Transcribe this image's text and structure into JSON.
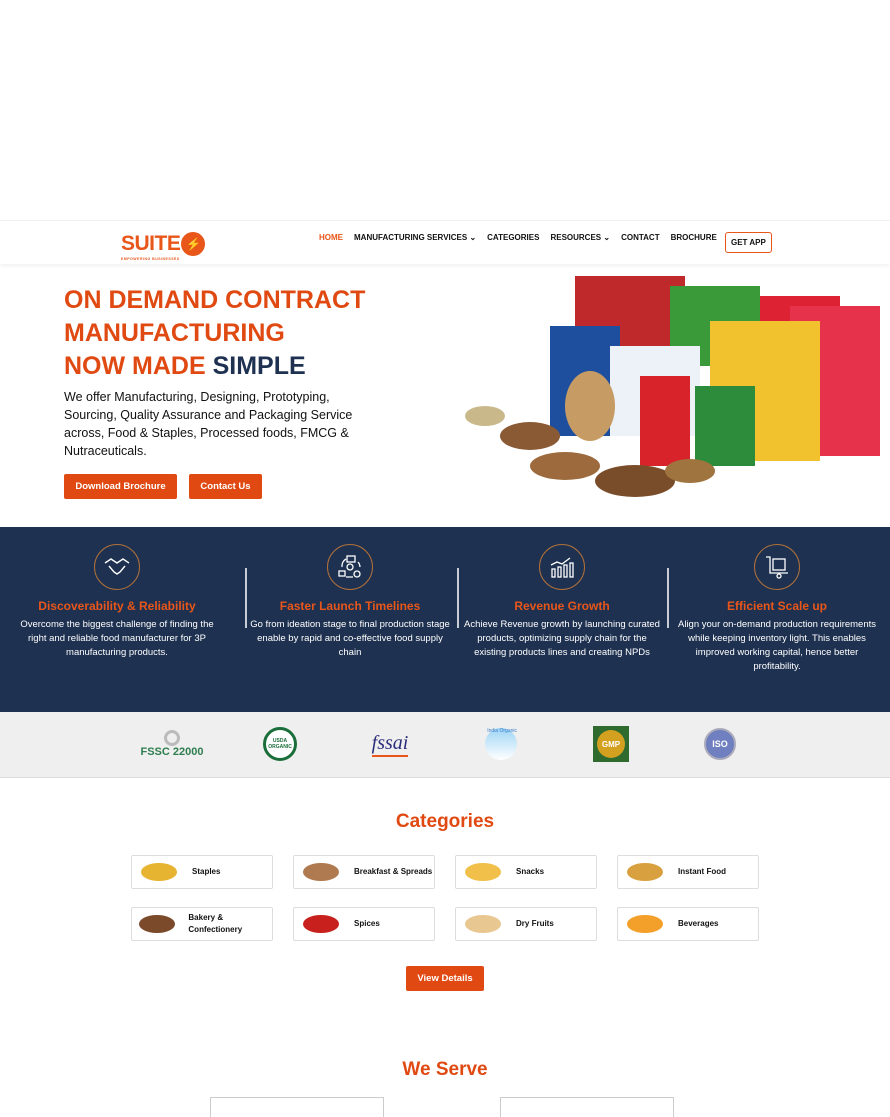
{
  "nav": {
    "logo": "SUITE",
    "logo_tagline": "EMPOWERING BUSINESSES",
    "items": [
      "HOME",
      "MANUFACTURING SERVICES",
      "CATEGORIES",
      "RESOURCES",
      "CONTACT",
      "BROCHURE"
    ],
    "get_app": "GET APP"
  },
  "hero": {
    "line1": "ON DEMAND CONTRACT",
    "line2": "MANUFACTURING",
    "line3a": "NOW MADE ",
    "line3b": "SIMPLE",
    "text": "We offer Manufacturing, Designing, Prototyping, Sourcing, Quality Assurance and Packaging Service across, Food & Staples, Processed foods, FMCG & Nutraceuticals.",
    "btn_brochure": "Download Brochure",
    "btn_contact": "Contact Us"
  },
  "features": [
    {
      "title": "Discoverability & Reliability",
      "text": "Overcome the biggest challenge of finding the right and reliable food manufacturer for 3P manufacturing products."
    },
    {
      "title": "Faster Launch Timelines",
      "text": "Go from ideation stage to final production stage enable by rapid and co-effective food supply chain"
    },
    {
      "title": "Revenue Growth",
      "text": "Achieve Revenue growth by launching curated products, optimizing supply chain for the existing products lines and creating NPDs"
    },
    {
      "title": "Efficient Scale up",
      "text": "Align your on-demand production requirements while keeping inventory light. This enables improved working capital, hence better profitability."
    }
  ],
  "certs": [
    "FSSC 22000",
    "USDA ORGANIC",
    "fssai",
    "India Organic",
    "GMP",
    "ISO"
  ],
  "categories": {
    "title": "Categories",
    "items": [
      "Staples",
      "Breakfast & Spreads",
      "Snacks",
      "Instant Food",
      "Bakery & Confectionery",
      "Spices",
      "Dry Fruits",
      "Beverages"
    ],
    "button": "View Details"
  },
  "serve": {
    "title": "We Serve"
  },
  "colors": {
    "accent": "#e04a12",
    "navy": "#1e3150"
  }
}
